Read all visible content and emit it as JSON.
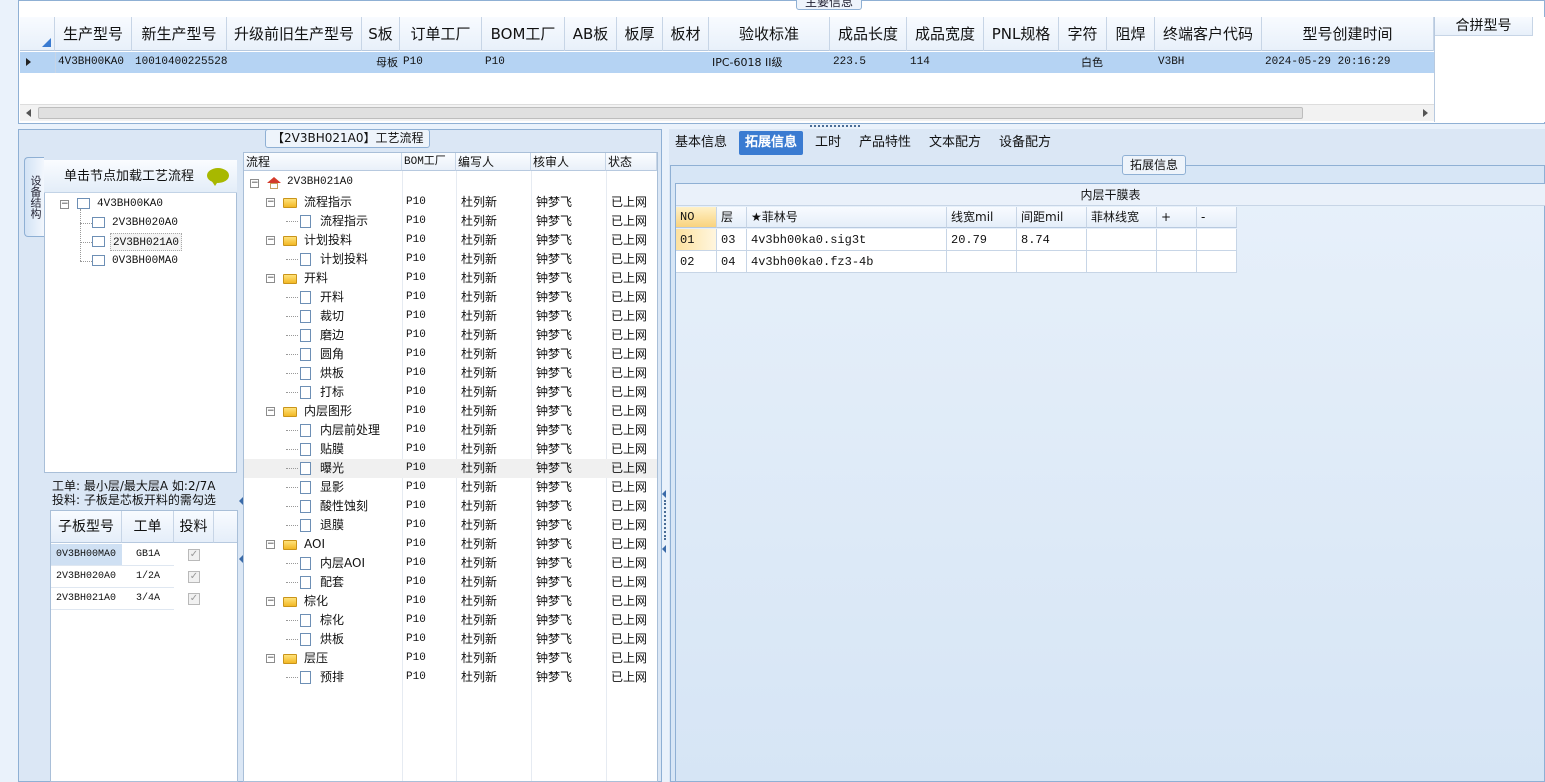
{
  "main": {
    "legend": "主要信息",
    "columns": [
      "生产型号",
      "新生产型号",
      "升级前旧生产型号",
      "S板",
      "订单工厂",
      "BOM工厂",
      "AB板",
      "板厚",
      "板材",
      "验收标准",
      "成品长度",
      "成品宽度",
      "PNL规格",
      "字符",
      "阻焊",
      "终端客户代码",
      "型号创建时间"
    ],
    "row": {
      "prod_model": "4V3BH00KA0",
      "new_model": "10010400225528",
      "old_model": "",
      "s_board": "母板",
      "order_factory": "P10",
      "bom_factory": "P10",
      "ab_board": "",
      "thickness": "",
      "material": "",
      "standard": "IPC-6018 II级",
      "length": "223.5",
      "width": "114",
      "pnl": "",
      "char": "白色",
      "solder": "",
      "customer": "V3BH",
      "created": "2024-05-29 20:16:29"
    },
    "merge_header": "合拼型号"
  },
  "process": {
    "legend": "【2V3BH021A0】工艺流程",
    "side_tab": "设备结构",
    "node_hint": "单击节点加载工艺流程",
    "tree": [
      "4V3BH00KA0",
      "2V3BH020A0",
      "2V3BH021A0",
      "0V3BH00MA0"
    ],
    "info_line1": "工单: 最小层/最大层A 如:2/7A",
    "info_line2": "投料: 子板是芯板开料的需勾选",
    "sub_headers": [
      "子板型号",
      "工单",
      "投料"
    ],
    "sub_rows": [
      {
        "model": "0V3BH00MA0",
        "order": "GB1A"
      },
      {
        "model": "2V3BH020A0",
        "order": "1/2A"
      },
      {
        "model": "2V3BH021A0",
        "order": "3/4A"
      }
    ],
    "flow_headers": [
      "流程",
      "BOM工厂",
      "编写人",
      "核审人",
      "状态"
    ],
    "flow_root": "2V3BH021A0",
    "flow_rows": [
      {
        "name": "流程指示",
        "lvl": 1,
        "factory": "P10",
        "writer": "杜列新",
        "reviewer": "钟梦飞",
        "status": "已上网"
      },
      {
        "name": "流程指示",
        "lvl": 2,
        "factory": "P10",
        "writer": "杜列新",
        "reviewer": "钟梦飞",
        "status": "已上网"
      },
      {
        "name": "计划投料",
        "lvl": 1,
        "factory": "P10",
        "writer": "杜列新",
        "reviewer": "钟梦飞",
        "status": "已上网"
      },
      {
        "name": "计划投料",
        "lvl": 2,
        "factory": "P10",
        "writer": "杜列新",
        "reviewer": "钟梦飞",
        "status": "已上网"
      },
      {
        "name": "开料",
        "lvl": 1,
        "factory": "P10",
        "writer": "杜列新",
        "reviewer": "钟梦飞",
        "status": "已上网"
      },
      {
        "name": "开料",
        "lvl": 2,
        "factory": "P10",
        "writer": "杜列新",
        "reviewer": "钟梦飞",
        "status": "已上网"
      },
      {
        "name": "裁切",
        "lvl": 2,
        "factory": "P10",
        "writer": "杜列新",
        "reviewer": "钟梦飞",
        "status": "已上网"
      },
      {
        "name": "磨边",
        "lvl": 2,
        "factory": "P10",
        "writer": "杜列新",
        "reviewer": "钟梦飞",
        "status": "已上网"
      },
      {
        "name": "圆角",
        "lvl": 2,
        "factory": "P10",
        "writer": "杜列新",
        "reviewer": "钟梦飞",
        "status": "已上网"
      },
      {
        "name": "烘板",
        "lvl": 2,
        "factory": "P10",
        "writer": "杜列新",
        "reviewer": "钟梦飞",
        "status": "已上网"
      },
      {
        "name": "打标",
        "lvl": 2,
        "factory": "P10",
        "writer": "杜列新",
        "reviewer": "钟梦飞",
        "status": "已上网"
      },
      {
        "name": "内层图形",
        "lvl": 1,
        "factory": "P10",
        "writer": "杜列新",
        "reviewer": "钟梦飞",
        "status": "已上网"
      },
      {
        "name": "内层前处理",
        "lvl": 2,
        "factory": "P10",
        "writer": "杜列新",
        "reviewer": "钟梦飞",
        "status": "已上网"
      },
      {
        "name": "贴膜",
        "lvl": 2,
        "factory": "P10",
        "writer": "杜列新",
        "reviewer": "钟梦飞",
        "status": "已上网"
      },
      {
        "name": "曝光",
        "lvl": 2,
        "factory": "P10",
        "writer": "杜列新",
        "reviewer": "钟梦飞",
        "status": "已上网"
      },
      {
        "name": "显影",
        "lvl": 2,
        "factory": "P10",
        "writer": "杜列新",
        "reviewer": "钟梦飞",
        "status": "已上网"
      },
      {
        "name": "酸性蚀刻",
        "lvl": 2,
        "factory": "P10",
        "writer": "杜列新",
        "reviewer": "钟梦飞",
        "status": "已上网"
      },
      {
        "name": "退膜",
        "lvl": 2,
        "factory": "P10",
        "writer": "杜列新",
        "reviewer": "钟梦飞",
        "status": "已上网"
      },
      {
        "name": "AOI",
        "lvl": 1,
        "factory": "P10",
        "writer": "杜列新",
        "reviewer": "钟梦飞",
        "status": "已上网"
      },
      {
        "name": "内层AOI",
        "lvl": 2,
        "factory": "P10",
        "writer": "杜列新",
        "reviewer": "钟梦飞",
        "status": "已上网"
      },
      {
        "name": "配套",
        "lvl": 2,
        "factory": "P10",
        "writer": "杜列新",
        "reviewer": "钟梦飞",
        "status": "已上网"
      },
      {
        "name": "棕化",
        "lvl": 1,
        "factory": "P10",
        "writer": "杜列新",
        "reviewer": "钟梦飞",
        "status": "已上网"
      },
      {
        "name": "棕化",
        "lvl": 2,
        "factory": "P10",
        "writer": "杜列新",
        "reviewer": "钟梦飞",
        "status": "已上网"
      },
      {
        "name": "烘板",
        "lvl": 2,
        "factory": "P10",
        "writer": "杜列新",
        "reviewer": "钟梦飞",
        "status": "已上网"
      },
      {
        "name": "层压",
        "lvl": 1,
        "factory": "P10",
        "writer": "杜列新",
        "reviewer": "钟梦飞",
        "status": "已上网"
      },
      {
        "name": "预排",
        "lvl": 2,
        "factory": "P10",
        "writer": "杜列新",
        "reviewer": "钟梦飞",
        "status": "已上网"
      }
    ]
  },
  "right": {
    "tabs": [
      "基本信息",
      "拓展信息",
      "工时",
      "产品特性",
      "文本配方",
      "设备配方"
    ],
    "active_tab": 1,
    "legend": "拓展信息",
    "table_title": "内层干膜表",
    "headers": [
      "NO",
      "层",
      "★菲林号",
      "线宽mil",
      "间距mil",
      "菲林线宽",
      "+",
      "-"
    ],
    "rows": [
      {
        "no": "01",
        "layer": "03",
        "film": "4v3bh00ka0.sig3t",
        "width": "20.79",
        "space": "8.74",
        "film_width": ""
      },
      {
        "no": "02",
        "layer": "04",
        "film": "4v3bh00ka0.fz3-4b",
        "width": "",
        "space": "",
        "film_width": ""
      }
    ]
  },
  "colors": {
    "accent": "#3a7bd1",
    "selected_row": "#b5d3f3",
    "panel": "#dbe7f5"
  }
}
